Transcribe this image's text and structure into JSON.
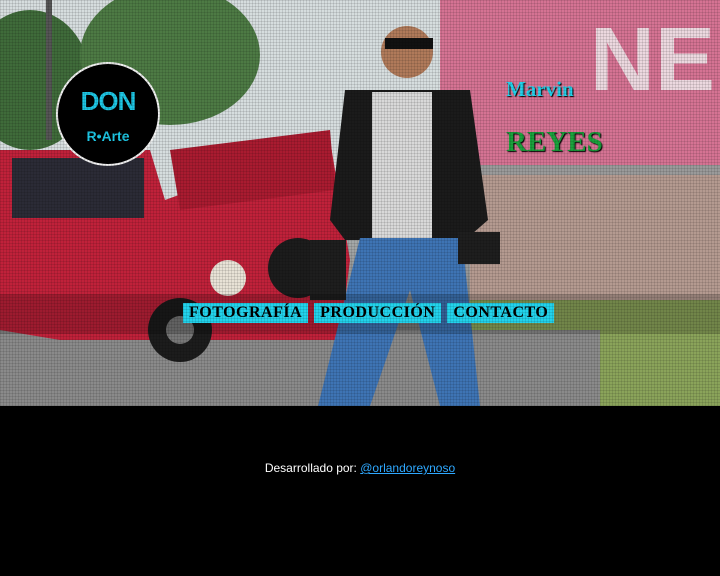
{
  "logo": {
    "top_text": "DON",
    "bottom_text": "R•Arte"
  },
  "hero": {
    "first_name": "Marvin",
    "last_name": "REYES"
  },
  "nav": {
    "items": [
      "FOTOGRAFÍA",
      "PRODUCCIÓN",
      "CONTACTO"
    ]
  },
  "footer": {
    "credit_prefix": "Desarrollado por:",
    "credit_link": "@orlandoreynoso"
  },
  "colors": {
    "accent": "#22d3ec",
    "last_name": "#1aa23c",
    "link": "#2ea8ff",
    "footer_bg": "#000000"
  }
}
